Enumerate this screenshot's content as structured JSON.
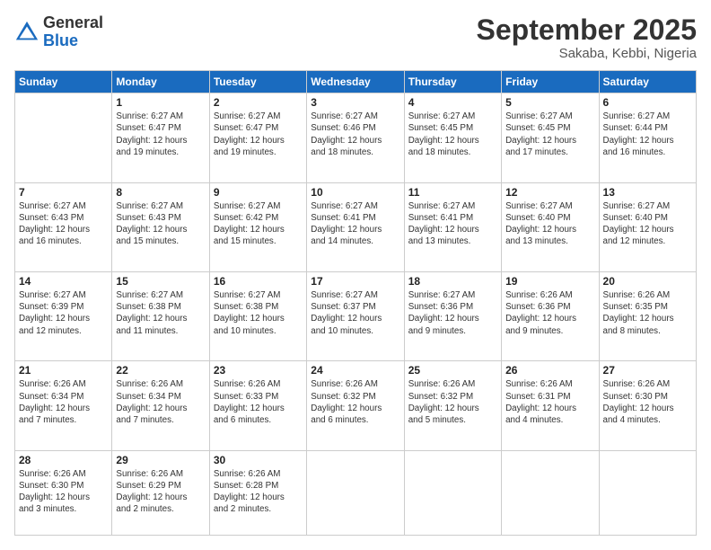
{
  "logo": {
    "general": "General",
    "blue": "Blue"
  },
  "header": {
    "month_year": "September 2025",
    "location": "Sakaba, Kebbi, Nigeria"
  },
  "days_of_week": [
    "Sunday",
    "Monday",
    "Tuesday",
    "Wednesday",
    "Thursday",
    "Friday",
    "Saturday"
  ],
  "weeks": [
    [
      {
        "day": "",
        "info": ""
      },
      {
        "day": "1",
        "info": "Sunrise: 6:27 AM\nSunset: 6:47 PM\nDaylight: 12 hours\nand 19 minutes."
      },
      {
        "day": "2",
        "info": "Sunrise: 6:27 AM\nSunset: 6:47 PM\nDaylight: 12 hours\nand 19 minutes."
      },
      {
        "day": "3",
        "info": "Sunrise: 6:27 AM\nSunset: 6:46 PM\nDaylight: 12 hours\nand 18 minutes."
      },
      {
        "day": "4",
        "info": "Sunrise: 6:27 AM\nSunset: 6:45 PM\nDaylight: 12 hours\nand 18 minutes."
      },
      {
        "day": "5",
        "info": "Sunrise: 6:27 AM\nSunset: 6:45 PM\nDaylight: 12 hours\nand 17 minutes."
      },
      {
        "day": "6",
        "info": "Sunrise: 6:27 AM\nSunset: 6:44 PM\nDaylight: 12 hours\nand 16 minutes."
      }
    ],
    [
      {
        "day": "7",
        "info": "Sunrise: 6:27 AM\nSunset: 6:43 PM\nDaylight: 12 hours\nand 16 minutes."
      },
      {
        "day": "8",
        "info": "Sunrise: 6:27 AM\nSunset: 6:43 PM\nDaylight: 12 hours\nand 15 minutes."
      },
      {
        "day": "9",
        "info": "Sunrise: 6:27 AM\nSunset: 6:42 PM\nDaylight: 12 hours\nand 15 minutes."
      },
      {
        "day": "10",
        "info": "Sunrise: 6:27 AM\nSunset: 6:41 PM\nDaylight: 12 hours\nand 14 minutes."
      },
      {
        "day": "11",
        "info": "Sunrise: 6:27 AM\nSunset: 6:41 PM\nDaylight: 12 hours\nand 13 minutes."
      },
      {
        "day": "12",
        "info": "Sunrise: 6:27 AM\nSunset: 6:40 PM\nDaylight: 12 hours\nand 13 minutes."
      },
      {
        "day": "13",
        "info": "Sunrise: 6:27 AM\nSunset: 6:40 PM\nDaylight: 12 hours\nand 12 minutes."
      }
    ],
    [
      {
        "day": "14",
        "info": "Sunrise: 6:27 AM\nSunset: 6:39 PM\nDaylight: 12 hours\nand 12 minutes."
      },
      {
        "day": "15",
        "info": "Sunrise: 6:27 AM\nSunset: 6:38 PM\nDaylight: 12 hours\nand 11 minutes."
      },
      {
        "day": "16",
        "info": "Sunrise: 6:27 AM\nSunset: 6:38 PM\nDaylight: 12 hours\nand 10 minutes."
      },
      {
        "day": "17",
        "info": "Sunrise: 6:27 AM\nSunset: 6:37 PM\nDaylight: 12 hours\nand 10 minutes."
      },
      {
        "day": "18",
        "info": "Sunrise: 6:27 AM\nSunset: 6:36 PM\nDaylight: 12 hours\nand 9 minutes."
      },
      {
        "day": "19",
        "info": "Sunrise: 6:26 AM\nSunset: 6:36 PM\nDaylight: 12 hours\nand 9 minutes."
      },
      {
        "day": "20",
        "info": "Sunrise: 6:26 AM\nSunset: 6:35 PM\nDaylight: 12 hours\nand 8 minutes."
      }
    ],
    [
      {
        "day": "21",
        "info": "Sunrise: 6:26 AM\nSunset: 6:34 PM\nDaylight: 12 hours\nand 7 minutes."
      },
      {
        "day": "22",
        "info": "Sunrise: 6:26 AM\nSunset: 6:34 PM\nDaylight: 12 hours\nand 7 minutes."
      },
      {
        "day": "23",
        "info": "Sunrise: 6:26 AM\nSunset: 6:33 PM\nDaylight: 12 hours\nand 6 minutes."
      },
      {
        "day": "24",
        "info": "Sunrise: 6:26 AM\nSunset: 6:32 PM\nDaylight: 12 hours\nand 6 minutes."
      },
      {
        "day": "25",
        "info": "Sunrise: 6:26 AM\nSunset: 6:32 PM\nDaylight: 12 hours\nand 5 minutes."
      },
      {
        "day": "26",
        "info": "Sunrise: 6:26 AM\nSunset: 6:31 PM\nDaylight: 12 hours\nand 4 minutes."
      },
      {
        "day": "27",
        "info": "Sunrise: 6:26 AM\nSunset: 6:30 PM\nDaylight: 12 hours\nand 4 minutes."
      }
    ],
    [
      {
        "day": "28",
        "info": "Sunrise: 6:26 AM\nSunset: 6:30 PM\nDaylight: 12 hours\nand 3 minutes."
      },
      {
        "day": "29",
        "info": "Sunrise: 6:26 AM\nSunset: 6:29 PM\nDaylight: 12 hours\nand 2 minutes."
      },
      {
        "day": "30",
        "info": "Sunrise: 6:26 AM\nSunset: 6:28 PM\nDaylight: 12 hours\nand 2 minutes."
      },
      {
        "day": "",
        "info": ""
      },
      {
        "day": "",
        "info": ""
      },
      {
        "day": "",
        "info": ""
      },
      {
        "day": "",
        "info": ""
      }
    ]
  ]
}
